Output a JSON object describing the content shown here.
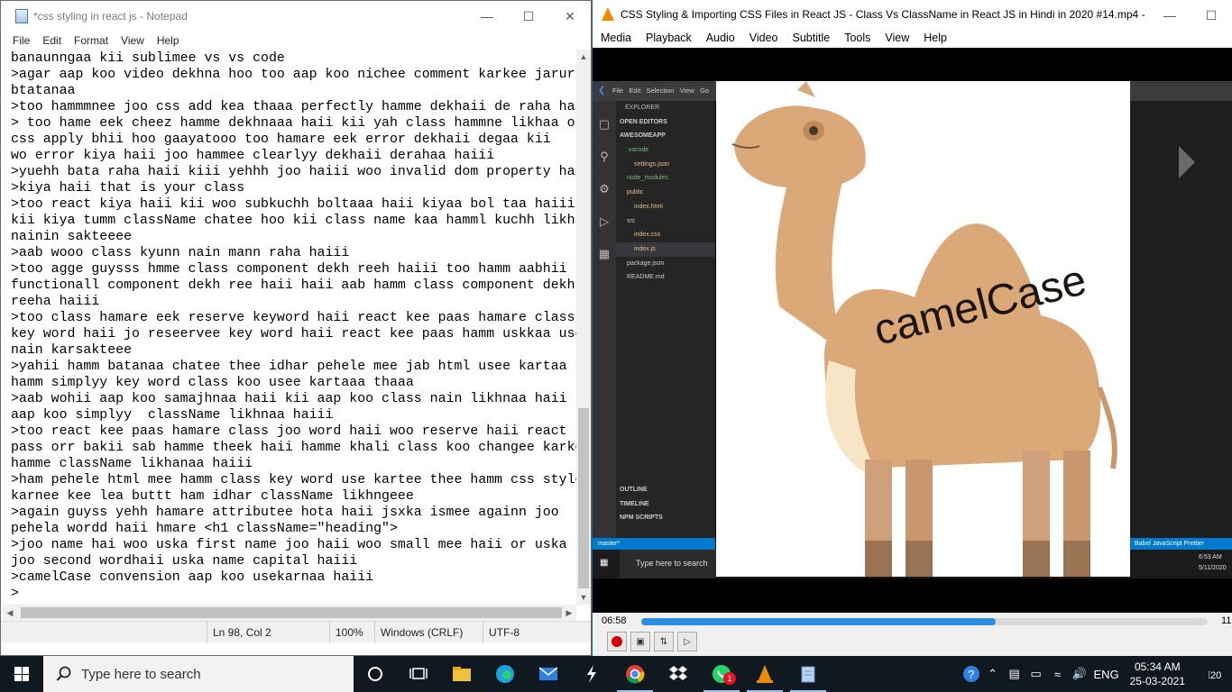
{
  "notepad": {
    "title": "*css styling in react js - Notepad",
    "menu": [
      "File",
      "Edit",
      "Format",
      "View",
      "Help"
    ],
    "content": "banaunngaa kii sublimee vs vs code\n>agar aap koo video dekhna hoo too aap koo nichee comment karkee jarur\nbtatanaa\n>too hammmnee joo css add kea thaaa perfectly hamme dekhaii de raha haiii\n> too hame eek cheez hamme dekhnaaa haii kii yah class hammne likhaa or\ncss apply bhii hoo gaayatooo too hamare eek error dekhaii degaa kii\nwo error kiya haii joo hammee clearlyy dekhaii derahaa haiii\n>yuehh bata raha haii kiii yehhh joo haiii woo invalid dom property haiii\n>kiya haii that is your class\n>too react kiya haii kii woo subkuchh boltaaa haii kiyaa bol taa haiii\nkii kiya tumm className chatee hoo kii class name kaa hamml kuchh likh hii\nnainin sakteeee\n>aab wooo class kyunn nain mann raha haiii\n>too agge guysss hmme class component dekh reeh haiii too hamm aabhii\nfunctionall component dekh ree haii haii aab hamm class component dekh\nreeha haiii\n>too class hamare eek reserve keyword haii react kee paas hamare class\nkey word haii jo reseervee key word haii react kee paas hamm uskkaa use\nnain karsakteee\n>yahii hamm batanaa chatee thee idhar pehele mee jab html usee kartaa tha\nhamm simplyy key word class koo usee kartaaa thaaa\n>aab wohii aap koo samajhnaa haii kii aap koo class nain likhnaa haii\naap koo simplyy  className likhnaa haiii\n>too react kee paas hamare class joo word haii woo reserve haii react kee\npass orr bakii sab hamme theek haii hamme khali class koo changee karkee\nhamme className likhanaa haiii\n>ham pehele html mee hamm class key word use kartee thee hamm css style add\nkarnee kee lea buttt ham idhar className likhngeee\n>again guyss yehh hamare attributee hota haii jsxka ismee againn joo\npehela wordd haii hmare <h1 className=\"heading\">\n>joo name hai woo uska first name joo haii woo small mee haii or uska\njoo second wordhaii uska name capital haiii\n>camelCase convension aap koo usekarnaa haiii\n>",
    "status": {
      "position": "Ln 98, Col 2",
      "zoom": "100%",
      "line_ending": "Windows (CRLF)",
      "encoding": "UTF-8"
    }
  },
  "vlc": {
    "title": "CSS Styling & Importing CSS Files in React JS - Class Vs ClassName in React JS in Hindi in 2020 #14.mp4 - ...",
    "menu": [
      "Media",
      "Playback",
      "Audio",
      "Video",
      "Subtitle",
      "Tools",
      "View",
      "Help"
    ],
    "elapsed": "06:58",
    "remaining": "11",
    "progress": 0.625,
    "video": {
      "camel_text": "camelCase",
      "explorer": [
        "EXPLORER",
        "OPEN EDITORS",
        "AWESOMEAPP",
        ".vscode",
        "settings.json",
        "node_modules",
        "public",
        "index.html",
        "src",
        "index.css",
        "index.js",
        "package.json",
        "README.md"
      ],
      "panels": [
        "OUTLINE",
        "TIMELINE",
        "NPM SCRIPTS"
      ],
      "vs_menu": [
        "File",
        "Edit",
        "Selection",
        "View",
        "Go"
      ],
      "status_left": "master*",
      "status_right": "Babel JavaScript   Prettier",
      "inner_search": "Type here to search",
      "inner_time": "6:53 AM",
      "inner_date": "5/11/2020"
    }
  },
  "taskbar": {
    "search_placeholder": "Type here to search",
    "time": "05:34 AM",
    "date": "25-03-2021",
    "language": "ENG",
    "notification_count": "20",
    "whatsapp_badge": "1"
  },
  "colors": {
    "taskbar": "#101820",
    "vlc_progress": "#2e8fe0",
    "vlc_orange": "#f08a00",
    "vscode_status": "#007acc"
  }
}
